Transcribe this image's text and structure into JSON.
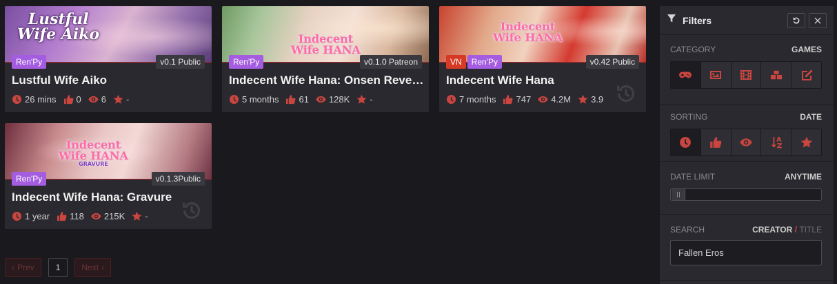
{
  "cards": [
    {
      "logo_line1": "Lustful",
      "logo_line2": "Wife Aiko",
      "tags": [
        "Ren'Py"
      ],
      "version": "v0.1 Public",
      "title": "Lustful Wife Aiko",
      "time": "26 mins",
      "likes": "0",
      "views": "6",
      "rating": "-",
      "history": false
    },
    {
      "logo_line1": "Indecent",
      "logo_line2": "Wife HANA",
      "tags": [
        "Ren'Py"
      ],
      "version": "v0.1.0 Patreon",
      "title": "Indecent Wife Hana: Onsen Revenge",
      "time": "5 months",
      "likes": "61",
      "views": "128K",
      "rating": "-",
      "history": false
    },
    {
      "logo_line1": "Indecent",
      "logo_line2": "Wife HANA",
      "tags": [
        "VN",
        "Ren'Py"
      ],
      "version": "v0.42 Public",
      "title": "Indecent Wife Hana",
      "time": "7 months",
      "likes": "747",
      "views": "4.2M",
      "rating": "3.9",
      "history": true
    },
    {
      "logo_line1": "Indecent",
      "logo_line2": "Wife HANA",
      "logo_line3": "GRAVURE",
      "tags": [
        "Ren'Py"
      ],
      "version": "v0.1.3Public",
      "title": "Indecent Wife Hana: Gravure",
      "time": "1 year",
      "likes": "118",
      "views": "215K",
      "rating": "-",
      "history": true
    }
  ],
  "pager": {
    "prev": "Prev",
    "page": "1",
    "next": "Next"
  },
  "filters": {
    "title": "Filters",
    "category": {
      "label": "CATEGORY",
      "value": "GAMES",
      "icons": [
        "gamepad-icon",
        "image-icon",
        "film-icon",
        "boxes-icon",
        "edit-icon"
      ]
    },
    "sorting": {
      "label": "SORTING",
      "value": "DATE",
      "icons": [
        "clock-icon",
        "thumbs-up-icon",
        "eye-icon",
        "sort-alpha-icon",
        "star-icon"
      ]
    },
    "date_limit": {
      "label": "DATE LIMIT",
      "value": "ANYTIME"
    },
    "search": {
      "label": "SEARCH",
      "mode_active": "CREATOR",
      "separator": "/",
      "mode_inactive": "TITLE",
      "value": "Fallen Eros"
    }
  },
  "colors": {
    "accent": "#c9453f",
    "renpy": "#a45ce0",
    "vn": "#d63a25",
    "card": "#2a292f",
    "background": "#1a191e"
  }
}
